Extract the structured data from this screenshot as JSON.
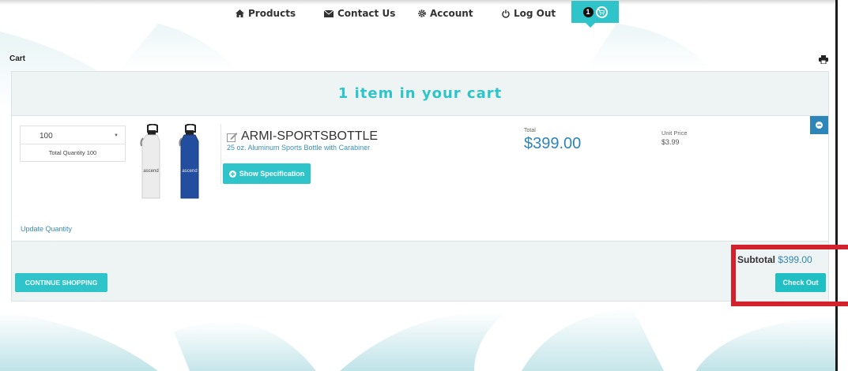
{
  "nav": {
    "products": "Products",
    "contact": "Contact Us",
    "account": "Account",
    "logout": "Log Out",
    "cart_count": "1"
  },
  "page": {
    "title": "Cart"
  },
  "cart": {
    "header": "1 item in your cart",
    "item": {
      "quantity": "100",
      "total_quantity": "Total Quantity 100",
      "image_text": "ascend",
      "name": "ARMI-SPORTSBOTTLE",
      "description": "25 oz. Aluminum Sports Bottle with Carabiner",
      "spec_button": "Show Specification",
      "total_label": "Total",
      "total_value": "$399.00",
      "unit_price_label": "Unit Price",
      "unit_price_value": "$3.99"
    },
    "update_quantity": "Update Quantity",
    "continue_button": "CONTINUE SHOPPING",
    "subtotal_label": "Subtotal",
    "subtotal_value": "$399.00",
    "checkout_button": "Check Out"
  },
  "colors": {
    "accent": "#2ec4c9",
    "link_blue": "#2e86b8",
    "highlight_red": "#d3212c"
  }
}
